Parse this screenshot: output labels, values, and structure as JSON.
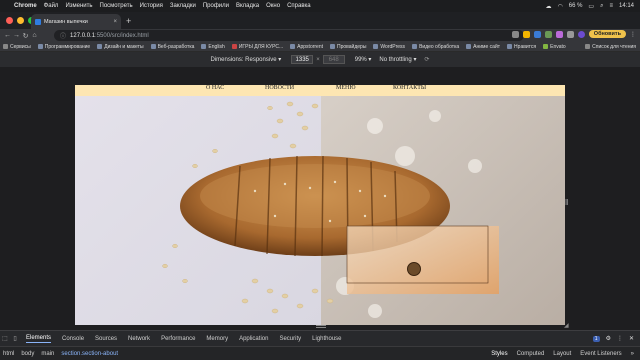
{
  "menubar": {
    "app": "Chrome",
    "items": [
      "Файл",
      "Изменить",
      "Посмотреть",
      "История",
      "Закладки",
      "Профили",
      "Вкладка",
      "Окно",
      "Справка"
    ],
    "battery": "66 %",
    "time": "14:14"
  },
  "tab": {
    "title": "Магазин выпечки",
    "close": "×",
    "new": "+"
  },
  "toolbar": {
    "url_host": "127.0.0.1",
    "url_port": ":5500",
    "url_path": "/src/index.html",
    "update_label": "Обновить"
  },
  "bookmarks": {
    "items": [
      "Сервисы",
      "Программирование",
      "Дизайн и макеты",
      "Веб-разработка",
      "English",
      "ИГРЫ ДЛЯ КУРС...",
      "Appstorrent",
      "Провайдеры",
      "WordPress",
      "Видео обработка",
      "Аниме сайт",
      "Нравится",
      "Envato"
    ],
    "right": "Список для чтения"
  },
  "devbar": {
    "dimensions": "Dimensions: Responsive ▾",
    "width": "1335",
    "height": "648",
    "zoom": "99% ▾",
    "throttle": "No throttling ▾"
  },
  "site": {
    "nav": [
      "О НАС",
      "НОВОСТИ",
      "МЕНЮ",
      "КОНТАКТЫ"
    ],
    "colors": {
      "page_bg": "#fde6b2",
      "card": "#e7b07a"
    }
  },
  "devtools": {
    "tabs": [
      "Elements",
      "Console",
      "Sources",
      "Network",
      "Performance",
      "Memory",
      "Application",
      "Security",
      "Lighthouse"
    ],
    "badge": "1",
    "breadcrumbs": [
      "html",
      "body",
      "main",
      "section.section-about"
    ],
    "side_tabs": [
      "Styles",
      "Computed",
      "Layout",
      "Event Listeners"
    ]
  }
}
